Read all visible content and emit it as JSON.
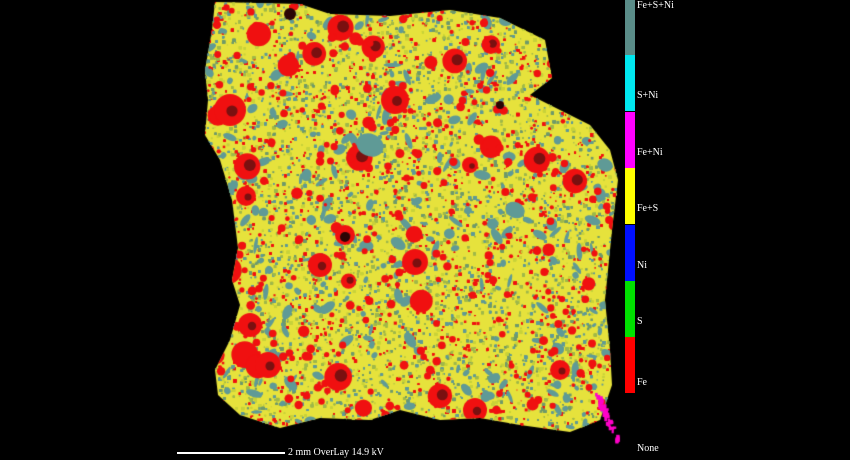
{
  "image": {
    "description_icon": "element-overlay-map",
    "colors": {
      "background": "#000000",
      "matrix_yellow": "#e6e23c",
      "matrix_green": "#6f9a6a",
      "teal": "#5f9a96",
      "red": "#f01010",
      "dark_red": "#7a1010",
      "magenta": "#ff00c8"
    }
  },
  "legend": {
    "items": [
      {
        "label": "Fe+S+Ni",
        "color": "#5a8c88"
      },
      {
        "label": "S+Ni",
        "color": "#00e8f0"
      },
      {
        "label": "Fe+Ni",
        "color": "#ff00ff"
      },
      {
        "label": "Fe+S",
        "color": "#ffff00"
      },
      {
        "label": "Ni",
        "color": "#0010ff"
      },
      {
        "label": "S",
        "color": "#00e000"
      },
      {
        "label": "Fe",
        "color": "#ff0000"
      }
    ],
    "none_label": "None"
  },
  "scale": {
    "text": "2 mm  OverLay  14.9 kV"
  }
}
